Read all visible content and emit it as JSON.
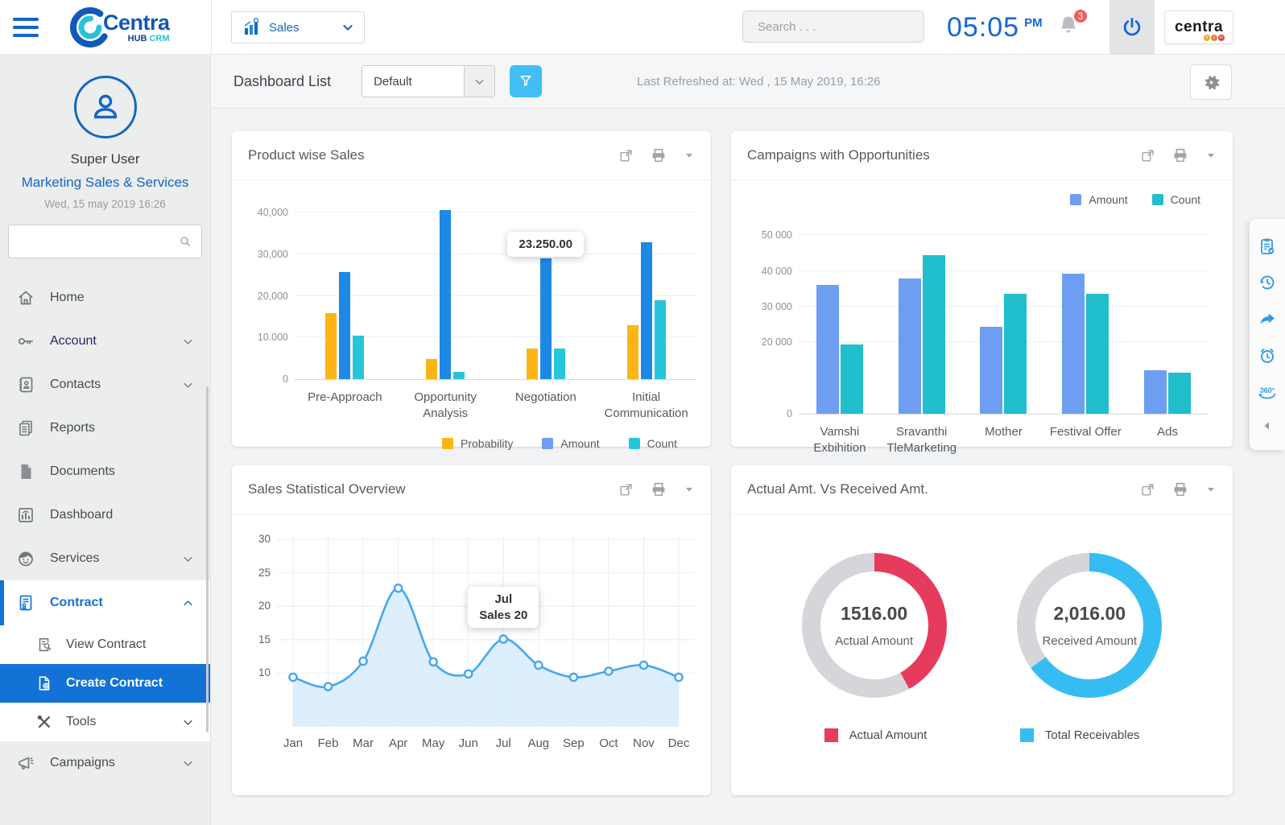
{
  "topbar": {
    "logo": {
      "brand": "Centra",
      "sub_bold": "HUB",
      "sub_accent": "CRM"
    },
    "module_select": {
      "label": "Sales"
    },
    "search": {
      "placeholder": "Search . . ."
    },
    "clock": {
      "time": "05:05",
      "meridiem": "PM"
    },
    "notifications": {
      "badge": "3"
    },
    "brand_box": {
      "name": "centra",
      "dots": [
        "h",
        "c",
        "m"
      ]
    }
  },
  "sidebar": {
    "profile": {
      "name": "Super User",
      "role": "Marketing Sales & Services",
      "datetime": "Wed, 15 may 2019 16:26"
    },
    "nav": [
      {
        "label": "Home"
      },
      {
        "label": "Account"
      },
      {
        "label": "Contacts"
      },
      {
        "label": "Reports"
      },
      {
        "label": "Documents"
      },
      {
        "label": "Dashboard"
      },
      {
        "label": "Services"
      },
      {
        "label": "Contract"
      },
      {
        "label": "View Contract"
      },
      {
        "label": "Create Contract"
      },
      {
        "label": "Tools"
      },
      {
        "label": "Campaigns"
      }
    ]
  },
  "dashboard_bar": {
    "title": "Dashboard List",
    "view_select": {
      "value": "Default"
    },
    "last_refreshed": "Last Refreshed at: Wed , 15 May 2019, 16:26"
  },
  "cards": [
    {
      "title": "Product wise Sales"
    },
    {
      "title": "Campaigns with Opportunities"
    },
    {
      "title": "Sales Statistical Overview"
    },
    {
      "title": "Actual Amt. Vs Received Amt."
    }
  ],
  "right_toolbar": {
    "icons": [
      "clipboard-check",
      "history",
      "share",
      "alarm-clock",
      "rotate-360",
      "collapse-left"
    ]
  },
  "chart_data": [
    {
      "type": "bar",
      "title": "Product wise Sales",
      "categories": [
        "Pre-Approach",
        "Opportunity\nAnalysis",
        "Negotiation",
        "Initial Communication"
      ],
      "series": [
        {
          "name": "Probability",
          "color": "#FDB515",
          "values": [
            15800,
            4800,
            7300,
            13000
          ]
        },
        {
          "name": "Amount",
          "color": "#1E88E5",
          "legend_color": "#6D9EF1",
          "values": [
            25800,
            40700,
            29000,
            33000
          ]
        },
        {
          "name": "Count",
          "color": "#26C6DA",
          "values": [
            10500,
            1800,
            7300,
            19000
          ]
        }
      ],
      "ylim": [
        0,
        42000
      ],
      "yticks": [
        {
          "label": "0",
          "value": 0
        },
        {
          "label": "10.000",
          "value": 10000
        },
        {
          "label": "20,000",
          "value": 20000
        },
        {
          "label": "30,000",
          "value": 30000
        },
        {
          "label": "40,000",
          "value": 40000
        }
      ],
      "legend_position": "bottom",
      "grid": true,
      "tooltip": {
        "category": 2,
        "series": 1,
        "text": "23.250.00"
      }
    },
    {
      "type": "bar",
      "title": "Campaigns with Opportunities",
      "categories": [
        "Vamshi\nExbihition",
        "Sravanthi\nTleMarketing",
        "Mother",
        "Festival Offer",
        "Ads"
      ],
      "series": [
        {
          "name": "Amount",
          "color": "#6D9EF1",
          "values": [
            36000,
            37800,
            24300,
            39300,
            12200
          ]
        },
        {
          "name": "Count",
          "color": "#21BECC",
          "values": [
            19500,
            44400,
            33700,
            33700,
            11500
          ]
        }
      ],
      "ylim": [
        0,
        55000
      ],
      "yticks": [
        {
          "label": "0",
          "value": 0
        },
        {
          "label": "20 000",
          "value": 20000
        },
        {
          "label": "30 000",
          "value": 30000
        },
        {
          "label": "40 000",
          "value": 40000
        },
        {
          "label": "50 000",
          "value": 50000
        }
      ],
      "legend_position": "top",
      "grid": true
    },
    {
      "type": "area",
      "title": "Sales Statistical Overview",
      "x": [
        "Jan",
        "Feb",
        "Mar",
        "Apr",
        "May",
        "Jun",
        "Jul",
        "Aug",
        "Sep",
        "Oct",
        "Nov",
        "Dec"
      ],
      "values": [
        9.4,
        8,
        11.8,
        22.7,
        11.7,
        9.9,
        15.1,
        11.2,
        9.4,
        10.3,
        11.2,
        9.4
      ],
      "ylim": [
        2,
        30.6
      ],
      "yticks": [
        10,
        15,
        20,
        25,
        30
      ],
      "line_color": "#45A6F2",
      "fill_color": "#D9EDFC",
      "grid": true,
      "tooltip": {
        "index": 6,
        "lines": [
          "Jul",
          "Sales 20"
        ]
      }
    },
    {
      "type": "donut",
      "title": "Actual Amt. Vs Received Amt.",
      "donuts": [
        {
          "value_label": "1516.00",
          "center_label": "Actual Amount",
          "percent": 42,
          "color": "#E73B5E",
          "track_color": "#D4D6D9"
        },
        {
          "value_label": "2,016.00",
          "center_label": "Received Amount",
          "percent": 65,
          "color": "#35BDF3",
          "track_color": "#D4D6D9"
        }
      ],
      "legend": [
        {
          "label": "Actual Amount",
          "color": "#E73B5E"
        },
        {
          "label": "Total Receivables",
          "color": "#35BDF3"
        }
      ]
    }
  ]
}
